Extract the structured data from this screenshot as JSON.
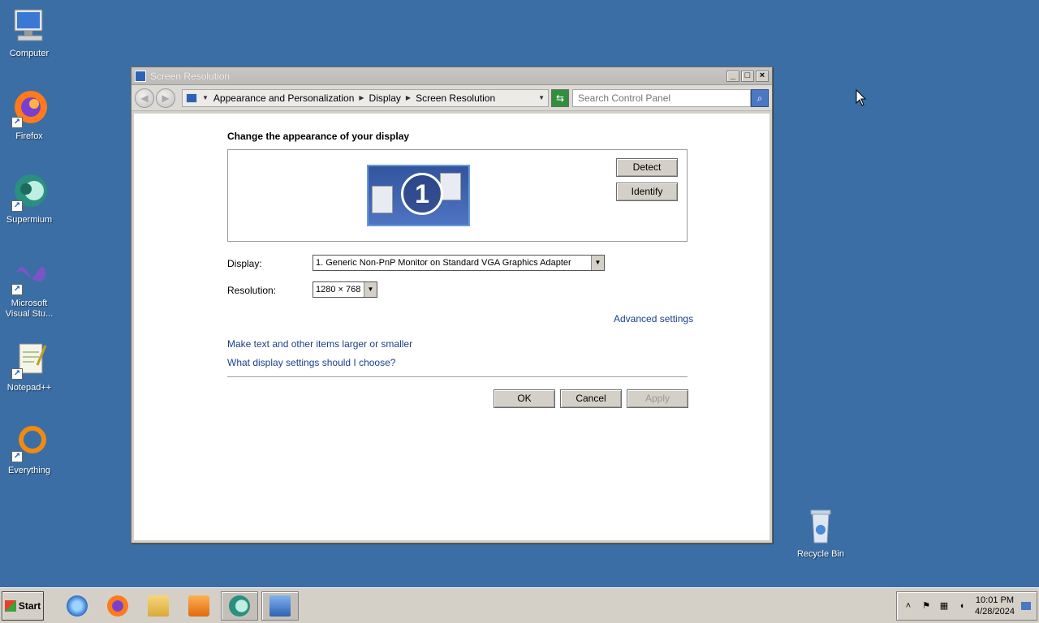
{
  "desktop": {
    "icons": [
      {
        "label": "Computer"
      },
      {
        "label": "Firefox"
      },
      {
        "label": "Supermium"
      },
      {
        "label": "Microsoft Visual Stu..."
      },
      {
        "label": "Notepad++"
      },
      {
        "label": "Everything"
      },
      {
        "label": "Recycle Bin"
      }
    ]
  },
  "window": {
    "title": "Screen Resolution",
    "controls": {
      "minimize": "_",
      "maximize": "□",
      "close": "×"
    },
    "breadcrumbs": [
      "Appearance and Personalization",
      "Display",
      "Screen Resolution"
    ],
    "search_placeholder": "Search Control Panel"
  },
  "content": {
    "heading": "Change the appearance of your display",
    "monitor_number": "1",
    "detect_label": "Detect",
    "identify_label": "Identify",
    "display_label": "Display:",
    "display_value": "1. Generic Non-PnP Monitor on Standard VGA Graphics Adapter",
    "resolution_label": "Resolution:",
    "resolution_value": "1280 × 768",
    "advanced_link": "Advanced settings",
    "text_size_link": "Make text and other items larger or smaller",
    "help_link": "What display settings should I choose?",
    "ok_label": "OK",
    "cancel_label": "Cancel",
    "apply_label": "Apply"
  },
  "taskbar": {
    "start_label": "Start",
    "clock_time": "10:01 PM",
    "clock_date": "4/28/2024"
  },
  "colors": {
    "desktop": "#3a6ea5",
    "link": "#1a3f8a",
    "chrome": "#d4d0c8"
  }
}
